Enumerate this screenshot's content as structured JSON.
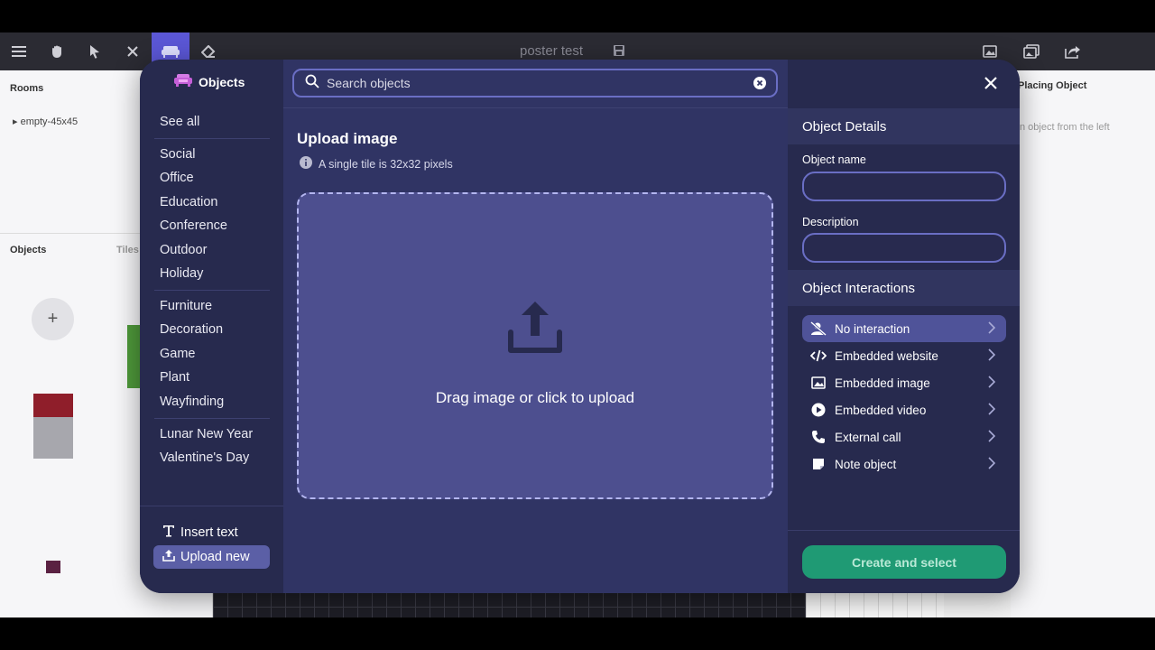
{
  "app": {
    "title": "poster test",
    "rooms_label": "Rooms",
    "room_item": "empty-45x45",
    "objects_tab": "Objects",
    "tiles_tab": "Tiles",
    "plus_label": "+",
    "placing_label": "Placing Object",
    "placing_hint": "n object from the left"
  },
  "modal": {
    "sidebar": {
      "title": "Objects",
      "see_all": "See all",
      "group1": [
        "Social",
        "Office",
        "Education",
        "Conference",
        "Outdoor",
        "Holiday"
      ],
      "group2": [
        "Furniture",
        "Decoration",
        "Game",
        "Plant",
        "Wayfinding"
      ],
      "group3": [
        "Lunar New Year",
        "Valentine's Day"
      ],
      "insert_text": "Insert text",
      "upload_new": "Upload new"
    },
    "search": {
      "placeholder": "Search objects"
    },
    "upload": {
      "title": "Upload image",
      "info": "A single tile is 32x32 pixels",
      "drop_text": "Drag image or click to upload"
    },
    "details": {
      "header": "Object Details",
      "name_label": "Object name",
      "description_label": "Description",
      "interactions_header": "Object Interactions",
      "interactions": [
        "No interaction",
        "Embedded website",
        "Embedded image",
        "Embedded video",
        "External call",
        "Note object"
      ],
      "create_button": "Create and select"
    }
  },
  "colors": {
    "accent": "#5b57d6",
    "modal_bg": "#282a4f",
    "center_bg": "#303464",
    "dropzone_bg": "#4d4f8f",
    "create_green": "#1f9a74"
  }
}
